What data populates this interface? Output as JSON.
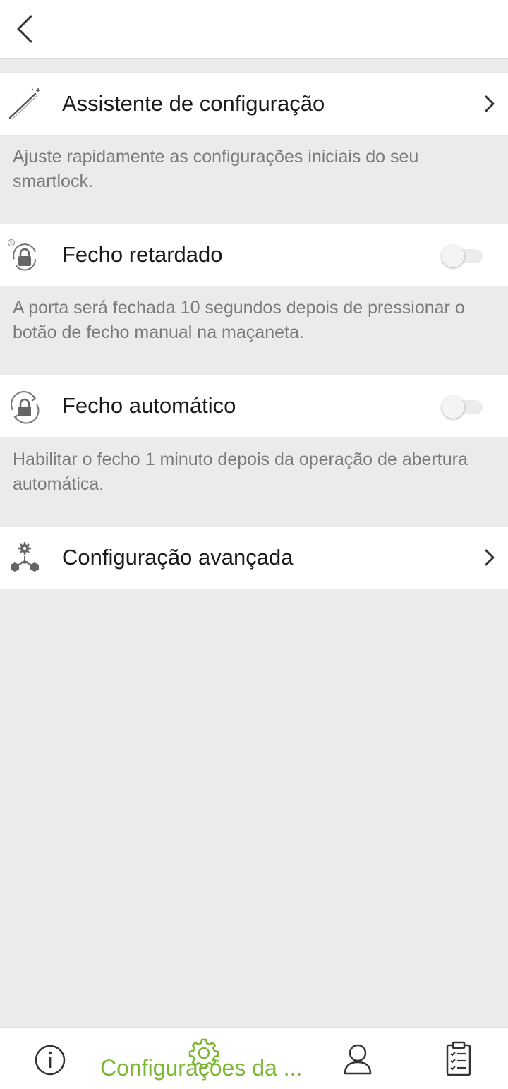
{
  "header": {
    "back_icon": "chevron-left-icon"
  },
  "settings": [
    {
      "icon": "magic-wand-icon",
      "label": "Assistente de configuração",
      "control": "chevron",
      "description": "Ajuste rapidamente as configurações iniciais do seu smartlock."
    },
    {
      "icon": "delayed-lock-icon",
      "label": "Fecho retardado",
      "control": "toggle",
      "enabled": false,
      "description": "A porta será fechada 10 segundos depois de pressionar o botão de fecho manual na maçaneta."
    },
    {
      "icon": "auto-lock-icon",
      "label": "Fecho automático",
      "control": "toggle",
      "enabled": false,
      "description": "Habilitar o fecho 1 minuto depois da operação de abertura automática."
    },
    {
      "icon": "advanced-settings-icon",
      "label": "Configuração avançada",
      "control": "chevron"
    }
  ],
  "bottom_nav": {
    "items": [
      {
        "icon": "info-icon",
        "active": false
      },
      {
        "icon": "gear-icon",
        "label": "Configurações da ...",
        "active": true
      },
      {
        "icon": "user-icon",
        "active": false
      },
      {
        "icon": "checklist-icon",
        "active": false
      }
    ],
    "active_color": "#7cb733"
  }
}
